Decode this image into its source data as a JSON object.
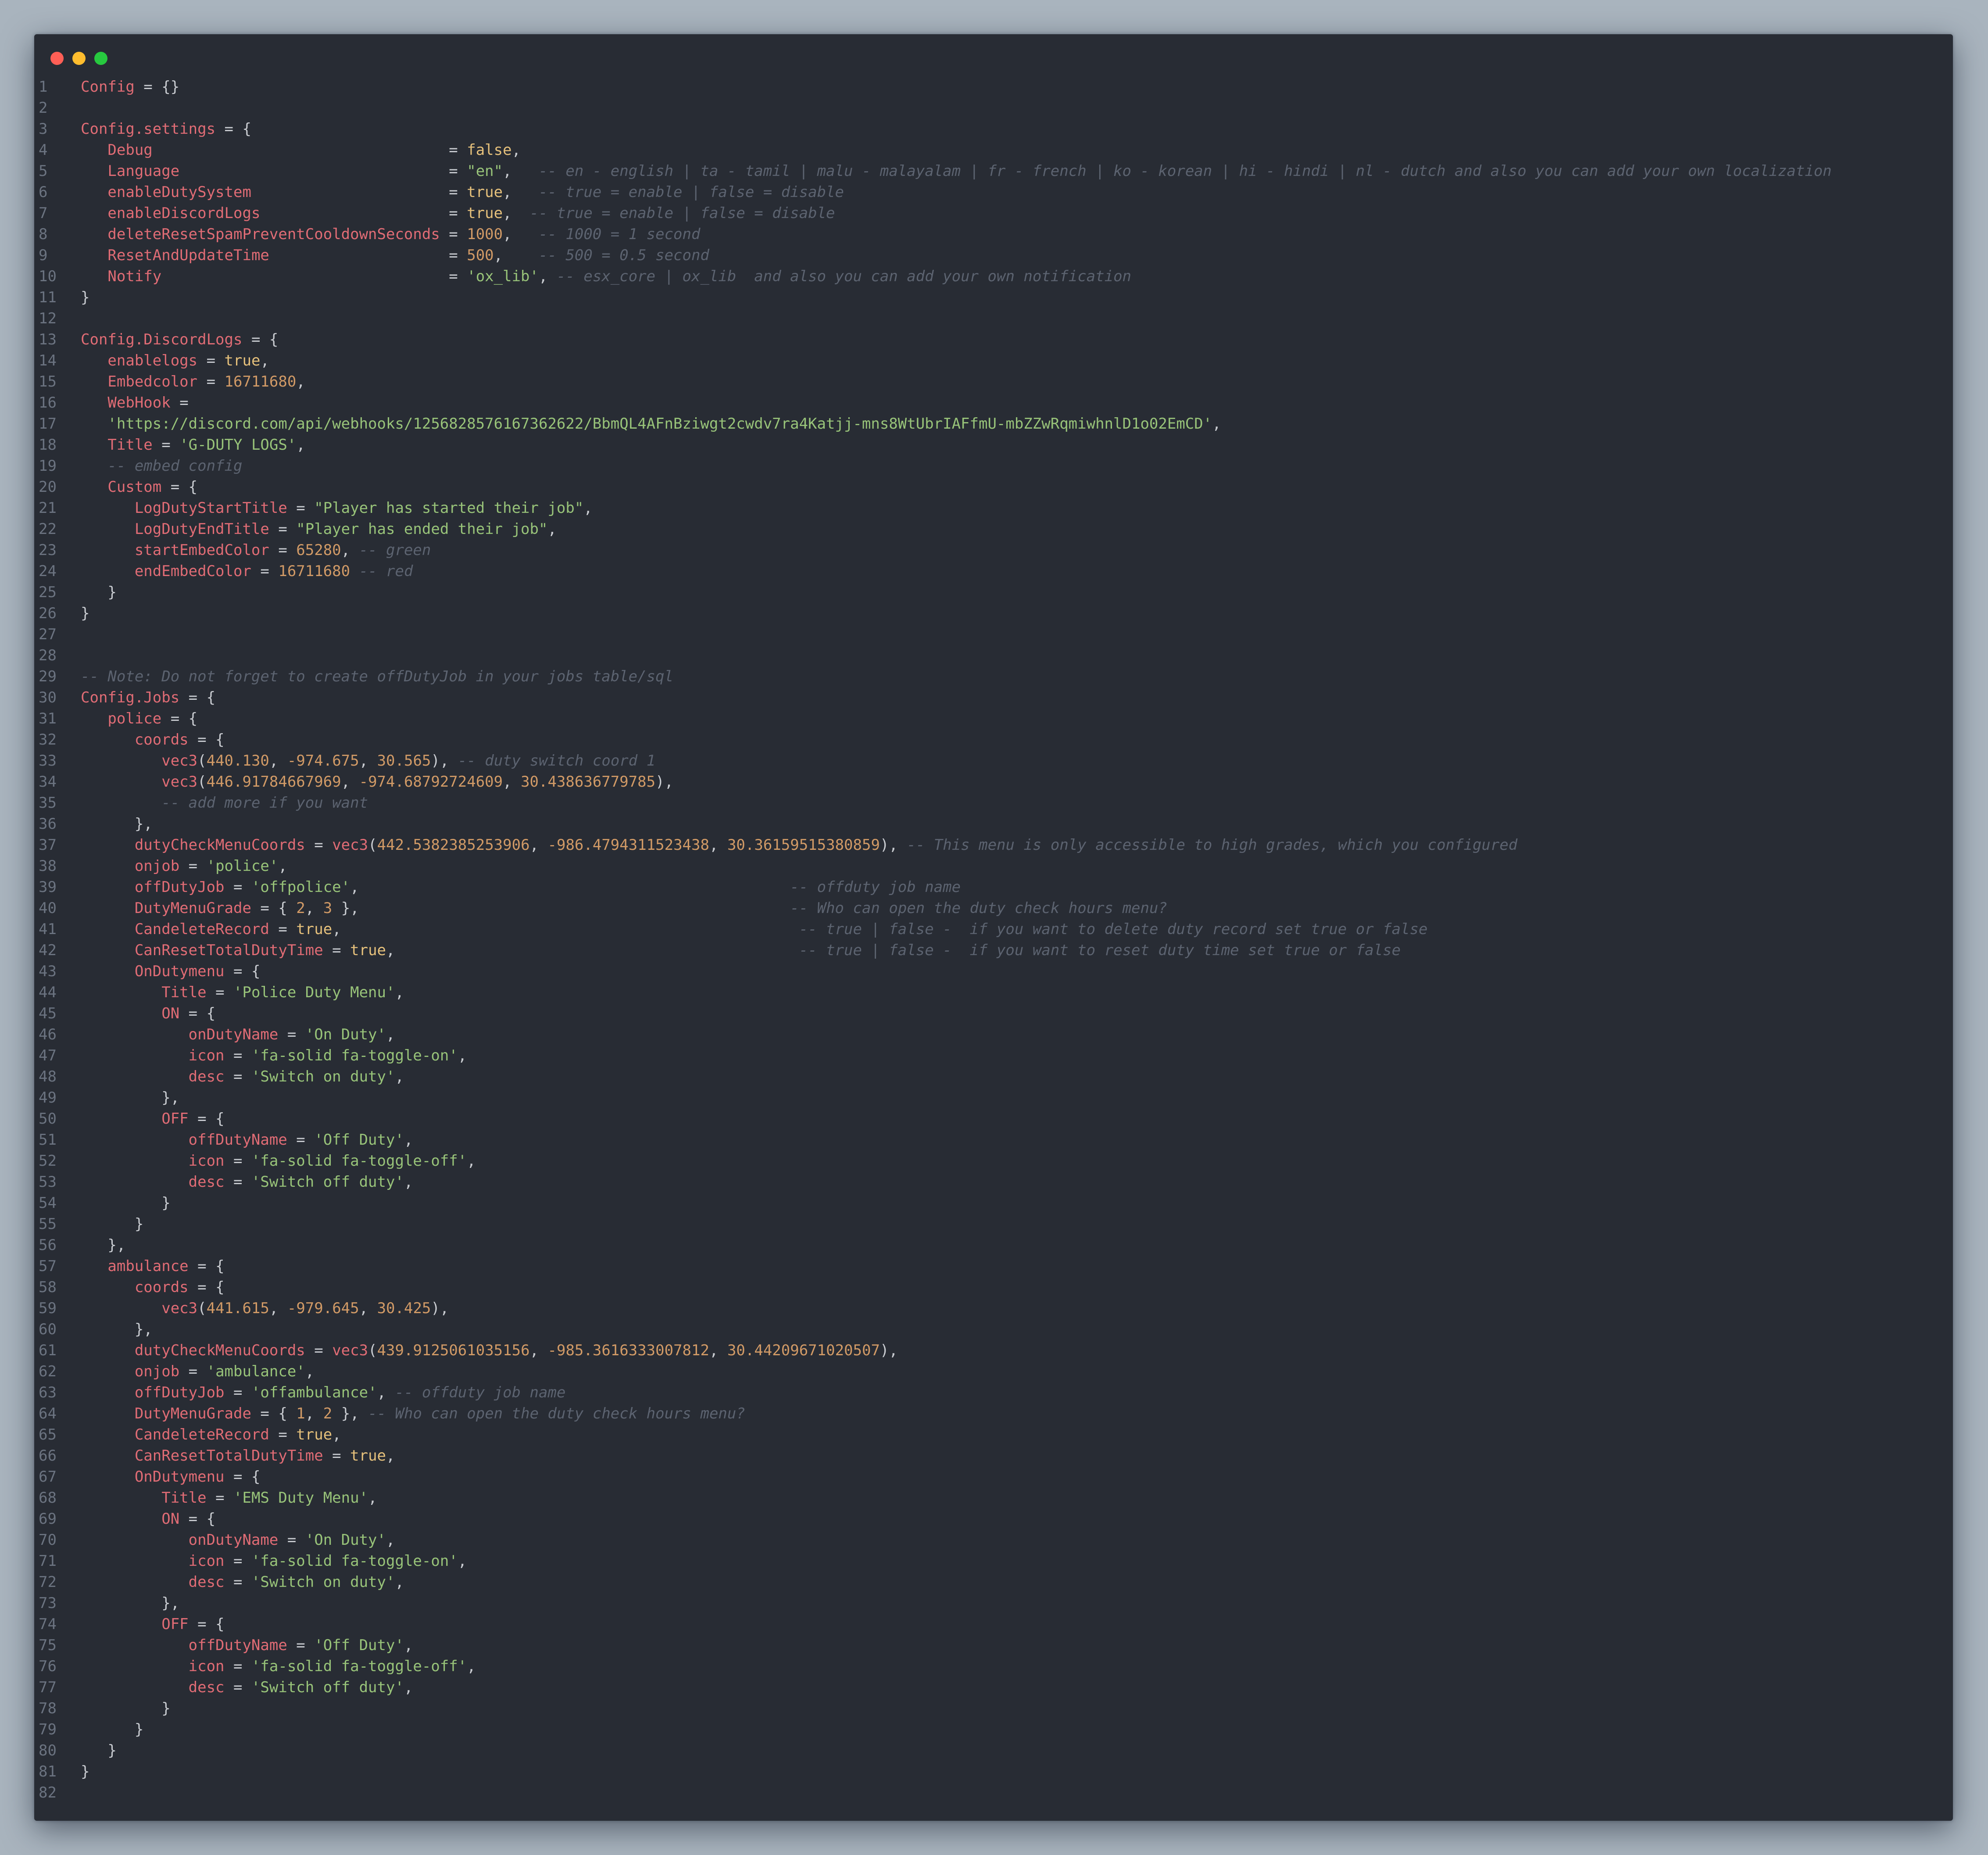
{
  "window": {
    "traffic_lights": [
      "close",
      "minimize",
      "maximize"
    ],
    "theme": {
      "background": "#282c34",
      "key": "#e06c75",
      "string": "#98c379",
      "number": "#d19a66",
      "comment": "#5c6370"
    }
  },
  "lines": [
    [
      [
        "k",
        "Config"
      ],
      [
        "p",
        " = {}"
      ]
    ],
    [],
    [
      [
        "k",
        "Config.settings"
      ],
      [
        "p",
        " = {"
      ]
    ],
    [
      [
        "p",
        "   "
      ],
      [
        "k",
        "Debug                                "
      ],
      [
        "p",
        " = "
      ],
      [
        "b",
        "false"
      ],
      [
        "p",
        ","
      ]
    ],
    [
      [
        "p",
        "   "
      ],
      [
        "k",
        "Language                             "
      ],
      [
        "p",
        " = "
      ],
      [
        "s",
        "\"en\""
      ],
      [
        "p",
        ",   "
      ],
      [
        "c",
        "-- en - english | ta - tamil | malu - malayalam | fr - french | ko - korean | hi - hindi | nl - dutch and also you can add your own localization"
      ]
    ],
    [
      [
        "p",
        "   "
      ],
      [
        "k",
        "enableDutySystem                     "
      ],
      [
        "p",
        " = "
      ],
      [
        "b",
        "true"
      ],
      [
        "p",
        ",   "
      ],
      [
        "c",
        "-- true = enable | false = disable"
      ]
    ],
    [
      [
        "p",
        "   "
      ],
      [
        "k",
        "enableDiscordLogs                    "
      ],
      [
        "p",
        " = "
      ],
      [
        "b",
        "true"
      ],
      [
        "p",
        ",  "
      ],
      [
        "c",
        "-- true = enable | false = disable"
      ]
    ],
    [
      [
        "p",
        "   "
      ],
      [
        "k",
        "deleteResetSpamPreventCooldownSeconds"
      ],
      [
        "p",
        " = "
      ],
      [
        "n",
        "1000"
      ],
      [
        "p",
        ",   "
      ],
      [
        "c",
        "-- 1000 = 1 second"
      ]
    ],
    [
      [
        "p",
        "   "
      ],
      [
        "k",
        "ResetAndUpdateTime                   "
      ],
      [
        "p",
        " = "
      ],
      [
        "n",
        "500"
      ],
      [
        "p",
        ",    "
      ],
      [
        "c",
        "-- 500 = 0.5 second"
      ]
    ],
    [
      [
        "p",
        "   "
      ],
      [
        "k",
        "Notify                               "
      ],
      [
        "p",
        " = "
      ],
      [
        "s",
        "'ox_lib'"
      ],
      [
        "p",
        ", "
      ],
      [
        "c",
        "-- esx_core | ox_lib  and also you can add your own notification"
      ]
    ],
    [
      [
        "p",
        "}"
      ]
    ],
    [],
    [
      [
        "k",
        "Config.DiscordLogs"
      ],
      [
        "p",
        " = {"
      ]
    ],
    [
      [
        "p",
        "   "
      ],
      [
        "k",
        "enablelogs"
      ],
      [
        "p",
        " = "
      ],
      [
        "b",
        "true"
      ],
      [
        "p",
        ","
      ]
    ],
    [
      [
        "p",
        "   "
      ],
      [
        "k",
        "Embedcolor"
      ],
      [
        "p",
        " = "
      ],
      [
        "n",
        "16711680"
      ],
      [
        "p",
        ","
      ]
    ],
    [
      [
        "p",
        "   "
      ],
      [
        "k",
        "WebHook"
      ],
      [
        "p",
        " ="
      ]
    ],
    [
      [
        "p",
        "   "
      ],
      [
        "s",
        "'https://discord.com/api/webhooks/1256828576167362622/BbmQL4AFnBziwgt2cwdv7ra4Katjj-mns8WtUbrIAFfmU-mbZZwRqmiwhnlD1o02EmCD'"
      ],
      [
        "p",
        ","
      ]
    ],
    [
      [
        "p",
        "   "
      ],
      [
        "k",
        "Title"
      ],
      [
        "p",
        " = "
      ],
      [
        "s",
        "'G-DUTY LOGS'"
      ],
      [
        "p",
        ","
      ]
    ],
    [
      [
        "p",
        "   "
      ],
      [
        "c",
        "-- embed config"
      ]
    ],
    [
      [
        "p",
        "   "
      ],
      [
        "k",
        "Custom"
      ],
      [
        "p",
        " = {"
      ]
    ],
    [
      [
        "p",
        "      "
      ],
      [
        "k",
        "LogDutyStartTitle"
      ],
      [
        "p",
        " = "
      ],
      [
        "s",
        "\"Player has started their job\""
      ],
      [
        "p",
        ","
      ]
    ],
    [
      [
        "p",
        "      "
      ],
      [
        "k",
        "LogDutyEndTitle"
      ],
      [
        "p",
        " = "
      ],
      [
        "s",
        "\"Player has ended their job\""
      ],
      [
        "p",
        ","
      ]
    ],
    [
      [
        "p",
        "      "
      ],
      [
        "k",
        "startEmbedColor"
      ],
      [
        "p",
        " = "
      ],
      [
        "n",
        "65280"
      ],
      [
        "p",
        ", "
      ],
      [
        "c",
        "-- green"
      ]
    ],
    [
      [
        "p",
        "      "
      ],
      [
        "k",
        "endEmbedColor"
      ],
      [
        "p",
        " = "
      ],
      [
        "n",
        "16711680"
      ],
      [
        "p",
        " "
      ],
      [
        "c",
        "-- red"
      ]
    ],
    [
      [
        "p",
        "   }"
      ]
    ],
    [
      [
        "p",
        "}"
      ]
    ],
    [],
    [],
    [
      [
        "c",
        "-- Note: Do not forget to create offDutyJob in your jobs table/sql"
      ]
    ],
    [
      [
        "k",
        "Config.Jobs"
      ],
      [
        "p",
        " = {"
      ]
    ],
    [
      [
        "p",
        "   "
      ],
      [
        "k",
        "police"
      ],
      [
        "p",
        " = {"
      ]
    ],
    [
      [
        "p",
        "      "
      ],
      [
        "k",
        "coords"
      ],
      [
        "p",
        " = {"
      ]
    ],
    [
      [
        "p",
        "         "
      ],
      [
        "f",
        "vec3"
      ],
      [
        "p",
        "("
      ],
      [
        "n",
        "440.130"
      ],
      [
        "p",
        ", "
      ],
      [
        "n",
        "-974.675"
      ],
      [
        "p",
        ", "
      ],
      [
        "n",
        "30.565"
      ],
      [
        "p",
        "), "
      ],
      [
        "c",
        "-- duty switch coord 1"
      ]
    ],
    [
      [
        "p",
        "         "
      ],
      [
        "f",
        "vec3"
      ],
      [
        "p",
        "("
      ],
      [
        "n",
        "446.91784667969"
      ],
      [
        "p",
        ", "
      ],
      [
        "n",
        "-974.68792724609"
      ],
      [
        "p",
        ", "
      ],
      [
        "n",
        "30.438636779785"
      ],
      [
        "p",
        "),"
      ]
    ],
    [
      [
        "p",
        "         "
      ],
      [
        "c",
        "-- add more if you want"
      ]
    ],
    [
      [
        "p",
        "      },"
      ]
    ],
    [
      [
        "p",
        "      "
      ],
      [
        "k",
        "dutyCheckMenuCoords"
      ],
      [
        "p",
        " = "
      ],
      [
        "f",
        "vec3"
      ],
      [
        "p",
        "("
      ],
      [
        "n",
        "442.5382385253906"
      ],
      [
        "p",
        ", "
      ],
      [
        "n",
        "-986.4794311523438"
      ],
      [
        "p",
        ", "
      ],
      [
        "n",
        "30.36159515380859"
      ],
      [
        "p",
        "), "
      ],
      [
        "c",
        "-- This menu is only accessible to high grades, which you configured"
      ]
    ],
    [
      [
        "p",
        "      "
      ],
      [
        "k",
        "onjob"
      ],
      [
        "p",
        " = "
      ],
      [
        "s",
        "'police'"
      ],
      [
        "p",
        ","
      ]
    ],
    [
      [
        "p",
        "      "
      ],
      [
        "k",
        "offDutyJob"
      ],
      [
        "p",
        " = "
      ],
      [
        "s",
        "'offpolice'"
      ],
      [
        "p",
        ",                                                "
      ],
      [
        "c",
        "-- offduty job name"
      ]
    ],
    [
      [
        "p",
        "      "
      ],
      [
        "k",
        "DutyMenuGrade"
      ],
      [
        "p",
        " = { "
      ],
      [
        "n",
        "2"
      ],
      [
        "p",
        ", "
      ],
      [
        "n",
        "3"
      ],
      [
        "p",
        " },                                                "
      ],
      [
        "c",
        "-- Who can open the duty check hours menu?"
      ]
    ],
    [
      [
        "p",
        "      "
      ],
      [
        "k",
        "CandeleteRecord"
      ],
      [
        "p",
        " = "
      ],
      [
        "b",
        "true"
      ],
      [
        "p",
        ",                                                   "
      ],
      [
        "c",
        "-- true | false -  if you want to delete duty record set true or false"
      ]
    ],
    [
      [
        "p",
        "      "
      ],
      [
        "k",
        "CanResetTotalDutyTime"
      ],
      [
        "p",
        " = "
      ],
      [
        "b",
        "true"
      ],
      [
        "p",
        ",                                             "
      ],
      [
        "c",
        "-- true | false -  if you want to reset duty time set true or false"
      ]
    ],
    [
      [
        "p",
        "      "
      ],
      [
        "k",
        "OnDutymenu"
      ],
      [
        "p",
        " = {"
      ]
    ],
    [
      [
        "p",
        "         "
      ],
      [
        "k",
        "Title"
      ],
      [
        "p",
        " = "
      ],
      [
        "s",
        "'Police Duty Menu'"
      ],
      [
        "p",
        ","
      ]
    ],
    [
      [
        "p",
        "         "
      ],
      [
        "k",
        "ON"
      ],
      [
        "p",
        " = {"
      ]
    ],
    [
      [
        "p",
        "            "
      ],
      [
        "k",
        "onDutyName"
      ],
      [
        "p",
        " = "
      ],
      [
        "s",
        "'On Duty'"
      ],
      [
        "p",
        ","
      ]
    ],
    [
      [
        "p",
        "            "
      ],
      [
        "k",
        "icon"
      ],
      [
        "p",
        " = "
      ],
      [
        "s",
        "'fa-solid fa-toggle-on'"
      ],
      [
        "p",
        ","
      ]
    ],
    [
      [
        "p",
        "            "
      ],
      [
        "k",
        "desc"
      ],
      [
        "p",
        " = "
      ],
      [
        "s",
        "'Switch on duty'"
      ],
      [
        "p",
        ","
      ]
    ],
    [
      [
        "p",
        "         },"
      ]
    ],
    [
      [
        "p",
        "         "
      ],
      [
        "k",
        "OFF"
      ],
      [
        "p",
        " = {"
      ]
    ],
    [
      [
        "p",
        "            "
      ],
      [
        "k",
        "offDutyName"
      ],
      [
        "p",
        " = "
      ],
      [
        "s",
        "'Off Duty'"
      ],
      [
        "p",
        ","
      ]
    ],
    [
      [
        "p",
        "            "
      ],
      [
        "k",
        "icon"
      ],
      [
        "p",
        " = "
      ],
      [
        "s",
        "'fa-solid fa-toggle-off'"
      ],
      [
        "p",
        ","
      ]
    ],
    [
      [
        "p",
        "            "
      ],
      [
        "k",
        "desc"
      ],
      [
        "p",
        " = "
      ],
      [
        "s",
        "'Switch off duty'"
      ],
      [
        "p",
        ","
      ]
    ],
    [
      [
        "p",
        "         }"
      ]
    ],
    [
      [
        "p",
        "      }"
      ]
    ],
    [
      [
        "p",
        "   },"
      ]
    ],
    [
      [
        "p",
        "   "
      ],
      [
        "k",
        "ambulance"
      ],
      [
        "p",
        " = {"
      ]
    ],
    [
      [
        "p",
        "      "
      ],
      [
        "k",
        "coords"
      ],
      [
        "p",
        " = {"
      ]
    ],
    [
      [
        "p",
        "         "
      ],
      [
        "f",
        "vec3"
      ],
      [
        "p",
        "("
      ],
      [
        "n",
        "441.615"
      ],
      [
        "p",
        ", "
      ],
      [
        "n",
        "-979.645"
      ],
      [
        "p",
        ", "
      ],
      [
        "n",
        "30.425"
      ],
      [
        "p",
        "),"
      ]
    ],
    [
      [
        "p",
        "      },"
      ]
    ],
    [
      [
        "p",
        "      "
      ],
      [
        "k",
        "dutyCheckMenuCoords"
      ],
      [
        "p",
        " = "
      ],
      [
        "f",
        "vec3"
      ],
      [
        "p",
        "("
      ],
      [
        "n",
        "439.9125061035156"
      ],
      [
        "p",
        ", "
      ],
      [
        "n",
        "-985.3616333007812"
      ],
      [
        "p",
        ", "
      ],
      [
        "n",
        "30.44209671020507"
      ],
      [
        "p",
        "),"
      ]
    ],
    [
      [
        "p",
        "      "
      ],
      [
        "k",
        "onjob"
      ],
      [
        "p",
        " = "
      ],
      [
        "s",
        "'ambulance'"
      ],
      [
        "p",
        ","
      ]
    ],
    [
      [
        "p",
        "      "
      ],
      [
        "k",
        "offDutyJob"
      ],
      [
        "p",
        " = "
      ],
      [
        "s",
        "'offambulance'"
      ],
      [
        "p",
        ", "
      ],
      [
        "c",
        "-- offduty job name"
      ]
    ],
    [
      [
        "p",
        "      "
      ],
      [
        "k",
        "DutyMenuGrade"
      ],
      [
        "p",
        " = { "
      ],
      [
        "n",
        "1"
      ],
      [
        "p",
        ", "
      ],
      [
        "n",
        "2"
      ],
      [
        "p",
        " }, "
      ],
      [
        "c",
        "-- Who can open the duty check hours menu?"
      ]
    ],
    [
      [
        "p",
        "      "
      ],
      [
        "k",
        "CandeleteRecord"
      ],
      [
        "p",
        " = "
      ],
      [
        "b",
        "true"
      ],
      [
        "p",
        ","
      ]
    ],
    [
      [
        "p",
        "      "
      ],
      [
        "k",
        "CanResetTotalDutyTime"
      ],
      [
        "p",
        " = "
      ],
      [
        "b",
        "true"
      ],
      [
        "p",
        ","
      ]
    ],
    [
      [
        "p",
        "      "
      ],
      [
        "k",
        "OnDutymenu"
      ],
      [
        "p",
        " = {"
      ]
    ],
    [
      [
        "p",
        "         "
      ],
      [
        "k",
        "Title"
      ],
      [
        "p",
        " = "
      ],
      [
        "s",
        "'EMS Duty Menu'"
      ],
      [
        "p",
        ","
      ]
    ],
    [
      [
        "p",
        "         "
      ],
      [
        "k",
        "ON"
      ],
      [
        "p",
        " = {"
      ]
    ],
    [
      [
        "p",
        "            "
      ],
      [
        "k",
        "onDutyName"
      ],
      [
        "p",
        " = "
      ],
      [
        "s",
        "'On Duty'"
      ],
      [
        "p",
        ","
      ]
    ],
    [
      [
        "p",
        "            "
      ],
      [
        "k",
        "icon"
      ],
      [
        "p",
        " = "
      ],
      [
        "s",
        "'fa-solid fa-toggle-on'"
      ],
      [
        "p",
        ","
      ]
    ],
    [
      [
        "p",
        "            "
      ],
      [
        "k",
        "desc"
      ],
      [
        "p",
        " = "
      ],
      [
        "s",
        "'Switch on duty'"
      ],
      [
        "p",
        ","
      ]
    ],
    [
      [
        "p",
        "         },"
      ]
    ],
    [
      [
        "p",
        "         "
      ],
      [
        "k",
        "OFF"
      ],
      [
        "p",
        " = {"
      ]
    ],
    [
      [
        "p",
        "            "
      ],
      [
        "k",
        "offDutyName"
      ],
      [
        "p",
        " = "
      ],
      [
        "s",
        "'Off Duty'"
      ],
      [
        "p",
        ","
      ]
    ],
    [
      [
        "p",
        "            "
      ],
      [
        "k",
        "icon"
      ],
      [
        "p",
        " = "
      ],
      [
        "s",
        "'fa-solid fa-toggle-off'"
      ],
      [
        "p",
        ","
      ]
    ],
    [
      [
        "p",
        "            "
      ],
      [
        "k",
        "desc"
      ],
      [
        "p",
        " = "
      ],
      [
        "s",
        "'Switch off duty'"
      ],
      [
        "p",
        ","
      ]
    ],
    [
      [
        "p",
        "         }"
      ]
    ],
    [
      [
        "p",
        "      }"
      ]
    ],
    [
      [
        "p",
        "   }"
      ]
    ],
    [
      [
        "p",
        "}"
      ]
    ],
    []
  ]
}
